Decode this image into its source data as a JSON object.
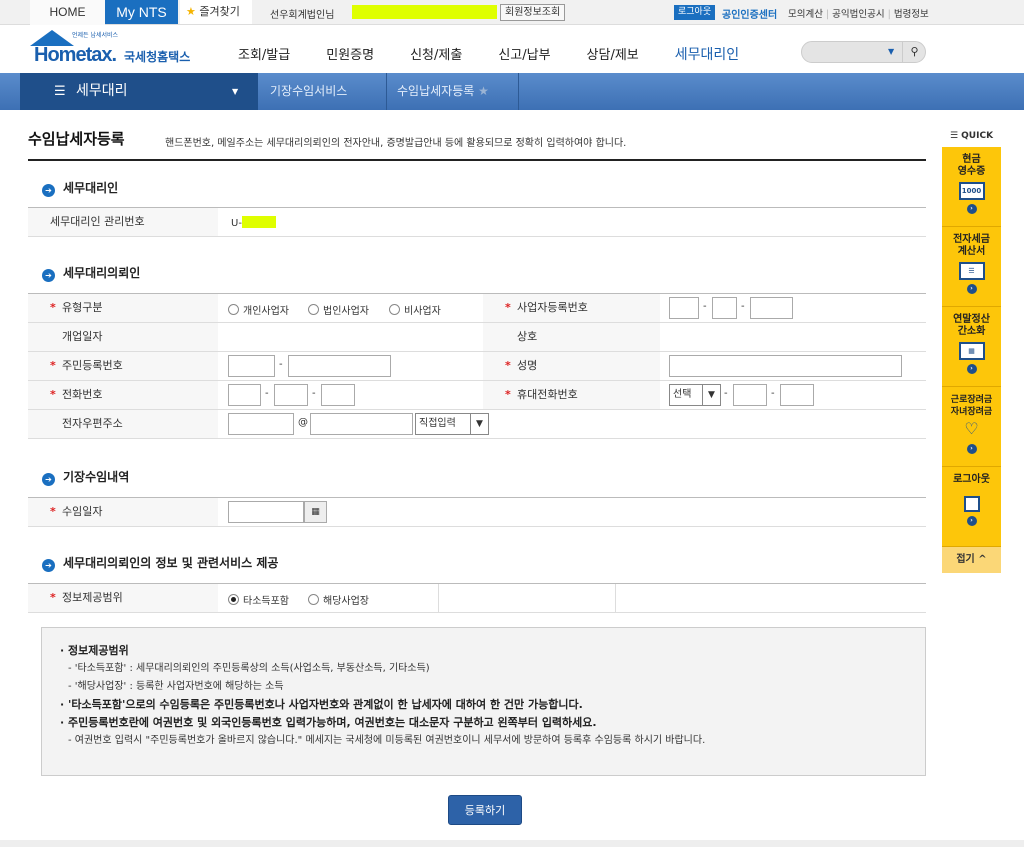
{
  "topbar": {
    "home": "HOME",
    "mynts": "My NTS",
    "favorites": "즐겨찾기",
    "user": "선우회계법인님",
    "member_info": "회원정보조회",
    "logout": "로그아웃",
    "cert_center": "공인인증센터",
    "links": [
      "모의계산",
      "공익법인공시",
      "법령정보"
    ]
  },
  "logo": {
    "tagline": "언제든 납세서비스",
    "word": "Hometax.",
    "korean": "국세청홈택스"
  },
  "gnb": [
    "조회/발급",
    "민원증명",
    "신청/제출",
    "신고/납부",
    "상담/제보",
    "세무대리인"
  ],
  "navbar": {
    "current": "세무대리",
    "crumbs": [
      "기장수임서비스",
      "수임납세자등록"
    ]
  },
  "page": {
    "title": "수임납세자등록",
    "description": "핸드폰번호, 메일주소는 세무대리의뢰인의 전자안내, 증명발급안내 등에 활용되므로 정확히 입력하여야 합니다."
  },
  "sections": {
    "agent": {
      "title": "세무대리인",
      "mgmt_label": "세무대리인 관리번호",
      "mgmt_value": "U-"
    },
    "client": {
      "title": "세무대리의뢰인",
      "type_label": "유형구분",
      "types": [
        "개인사업자",
        "법인사업자",
        "비사업자"
      ],
      "brn_label": "사업자등록번호",
      "open_date_label": "개업일자",
      "trade_name_label": "상호",
      "rrn_label": "주민등록번호",
      "name_label": "성명",
      "phone_label": "전화번호",
      "mobile_label": "휴대전화번호",
      "mobile_select": "선택",
      "email_label": "전자우편주소",
      "email_at": "@",
      "email_domain_select": "직접입력"
    },
    "engagement": {
      "title": "기장수임내역",
      "date_label": "수임일자"
    },
    "info": {
      "title": "세무대리의뢰인의 정보 및 관련서비스 제공",
      "scope_label": "정보제공범위",
      "options": [
        "타소득포함",
        "해당사업장"
      ],
      "selected": "타소득포함"
    }
  },
  "notes": [
    "정보제공범위",
    "- '타소득포함' : 세무대리의뢰인의 주민등록상의 소득(사업소득, 부동산소득, 기타소득)",
    "- '해당사업장' : 등록한 사업자번호에 해당하는 소득",
    "'타소득포함'으로의 수임등록은 주민등록번호나 사업자번호와 관계없이 한 납세자에 대하여 한 건만 가능합니다.",
    "주민등록번호란에 여권번호 및 외국인등록번호 입력가능하며, 여권번호는 대소문자 구분하고 왼쪽부터 입력하세요.",
    "- 여권번호 입력시 \"주민등록번호가 올바르지 않습니다.\" 메세지는 국세청에 미등록된 여권번호이니 세무서에 방문하여 등록후 수임등록 하시기 바랍니다."
  ],
  "submit": "등록하기",
  "quick": {
    "header": "QUICK",
    "items": [
      "현금\n영수증",
      "전자세금\n계산서",
      "연말정산\n간소화",
      "근로장려금\n자녀장려금",
      "로그아웃"
    ],
    "icon_text": "1000",
    "fold": "접기 ^"
  }
}
